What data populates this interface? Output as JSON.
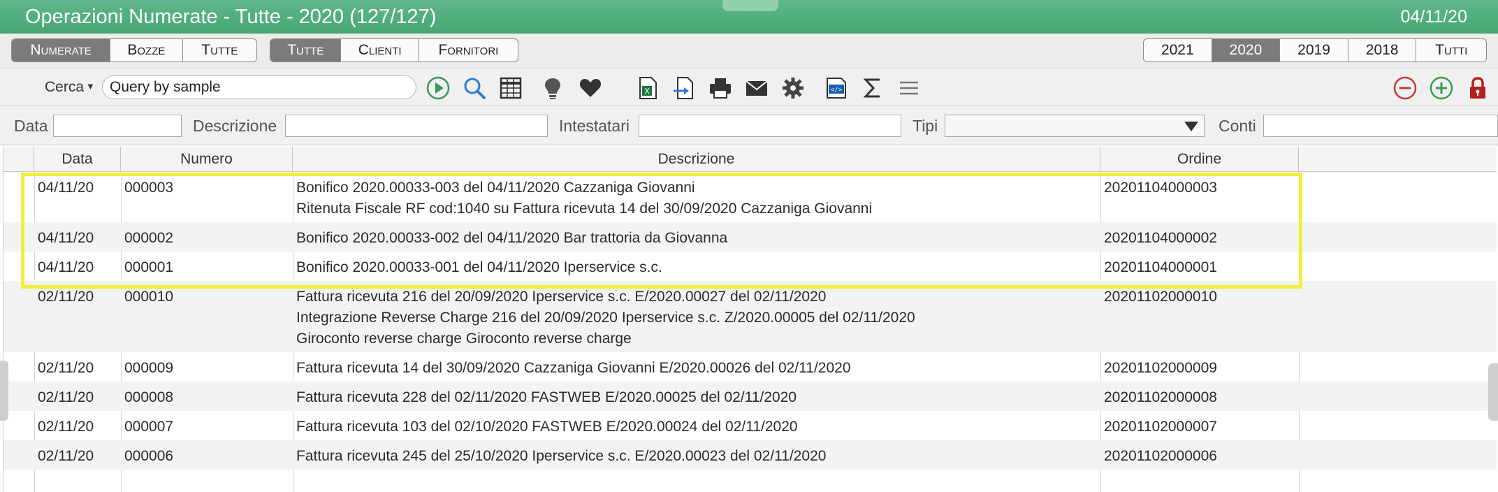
{
  "window": {
    "title": "Operazioni Numerate - Tutte - 2020 (127/127)",
    "date": "04/11/20"
  },
  "filters": {
    "status": [
      {
        "label": "Numerate",
        "active": true
      },
      {
        "label": "Bozze",
        "active": false
      },
      {
        "label": "Tutte",
        "active": false
      }
    ],
    "party": [
      {
        "label": "Tutte",
        "active": true
      },
      {
        "label": "Clienti",
        "active": false
      },
      {
        "label": "Fornitori",
        "active": false
      }
    ],
    "years": [
      {
        "label": "2021",
        "active": false
      },
      {
        "label": "2020",
        "active": true
      },
      {
        "label": "2019",
        "active": false
      },
      {
        "label": "2018",
        "active": false
      },
      {
        "label": "Tutti",
        "active": false
      }
    ]
  },
  "toolbar": {
    "search_mode": "Cerca",
    "query": "Query by sample",
    "icons": [
      "play-icon",
      "search-icon",
      "table-icon",
      "lightbulb-icon",
      "heart-icon",
      "excel-icon",
      "import-icon",
      "print-icon",
      "mail-icon",
      "gear-icon",
      "code-icon",
      "sum-icon",
      "menu-icon",
      "remove-icon",
      "add-icon",
      "lock-icon"
    ]
  },
  "field_filters": {
    "data_label": "Data",
    "descrizione_label": "Descrizione",
    "intestatari_label": "Intestatari",
    "tipi_label": "Tipi",
    "conti_label": "Conti"
  },
  "table": {
    "columns": [
      "Data",
      "Numero",
      "Descrizione",
      "Ordine"
    ],
    "rows": [
      {
        "data": "04/11/20",
        "numero": "000003",
        "descrizione": [
          "Bonifico 2020.00033-003 del 04/11/2020 Cazzaniga Giovanni",
          "Ritenuta Fiscale RF cod:1040 su Fattura ricevuta 14 del 30/09/2020 Cazzaniga Giovanni"
        ],
        "ordine": "20201104000003"
      },
      {
        "data": "04/11/20",
        "numero": "000002",
        "descrizione": [
          "Bonifico 2020.00033-002 del 04/11/2020 Bar trattoria da Giovanna"
        ],
        "ordine": "20201104000002"
      },
      {
        "data": "04/11/20",
        "numero": "000001",
        "descrizione": [
          "Bonifico 2020.00033-001 del 04/11/2020 Iperservice s.c."
        ],
        "ordine": "20201104000001"
      },
      {
        "data": "02/11/20",
        "numero": "000010",
        "descrizione": [
          "Fattura ricevuta 216 del 20/09/2020 Iperservice s.c. E/2020.00027 del 02/11/2020",
          "Integrazione Reverse Charge 216 del 20/09/2020 Iperservice s.c. Z/2020.00005 del 02/11/2020",
          "Giroconto reverse charge Giroconto reverse charge"
        ],
        "ordine": "20201102000010"
      },
      {
        "data": "02/11/20",
        "numero": "000009",
        "descrizione": [
          "Fattura ricevuta 14 del 30/09/2020 Cazzaniga Giovanni E/2020.00026 del 02/11/2020"
        ],
        "ordine": "20201102000009"
      },
      {
        "data": "02/11/20",
        "numero": "000008",
        "descrizione": [
          "Fattura ricevuta 228 del 02/11/2020 FASTWEB E/2020.00025 del 02/11/2020"
        ],
        "ordine": "20201102000008"
      },
      {
        "data": "02/11/20",
        "numero": "000007",
        "descrizione": [
          "Fattura ricevuta 103 del 02/10/2020 FASTWEB E/2020.00024 del 02/11/2020"
        ],
        "ordine": "20201102000007"
      },
      {
        "data": "02/11/20",
        "numero": "000006",
        "descrizione": [
          "Fattura ricevuta 245 del 25/10/2020 Iperservice s.c. E/2020.00023 del 02/11/2020"
        ],
        "ordine": "20201102000006"
      }
    ]
  },
  "colors": {
    "titlebar": "#4caa78",
    "highlight": "#f3ee3a",
    "active_segment": "#7b7b7b"
  }
}
